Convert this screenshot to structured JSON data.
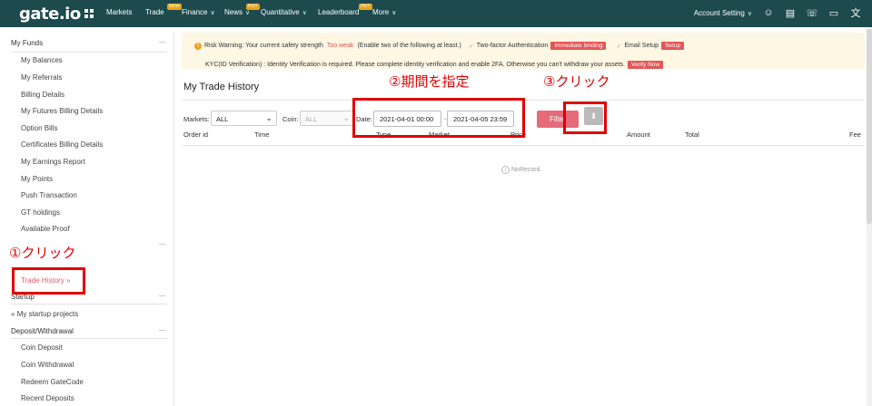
{
  "header": {
    "logo": "gate.io",
    "nav": [
      {
        "label": "Markets",
        "badge": ""
      },
      {
        "label": "Trade",
        "badge": "NEW"
      },
      {
        "label": "Finance",
        "badge": ""
      },
      {
        "label": "News",
        "badge": "HOT"
      },
      {
        "label": "Quantitative",
        "badge": ""
      },
      {
        "label": "Leaderboard",
        "badge": "HOT"
      },
      {
        "label": "More",
        "badge": ""
      }
    ],
    "account_setting": "Account Setting"
  },
  "sidebar": {
    "my_funds": "My Funds",
    "items": [
      "My Balances",
      "My Referrals",
      "Billing Details",
      "My Futures Billing Details",
      "Option Bills",
      "Certificates Billing Details",
      "My Earnings Report",
      "My Points",
      "Push Transaction",
      "GT holdings",
      "Available Proof"
    ],
    "trade_history": "Trade History",
    "trade_history_arrow": "»",
    "startup": "Startup",
    "startup_items": [
      "My startup projects"
    ],
    "deposit": "Deposit/Withdrawal",
    "deposit_items": [
      "Coin Deposit",
      "Coin Withdrawal",
      "Redeem GateCode",
      "Recent Deposits"
    ]
  },
  "warning": {
    "prefix": "Risk Warning: Your current safety strength",
    "strength": "Too weak",
    "enable_text": "(Enable two of the following at least.)",
    "two_factor": "Two-factor Authentication",
    "immediate_binding": "Immediate binding",
    "email_setup": "Email Setup",
    "setup": "Setup",
    "kyc_text": "KYC(ID Verification) : Identity Verification is required. Please complete identity verification and enable 2FA. Otherwise you can't withdraw your assets.",
    "verify_now": "Verify Now"
  },
  "page_title": "My Trade History",
  "filters": {
    "markets_label": "Markets:",
    "markets_value": "ALL",
    "coin_label": "Coin:",
    "coin_value": "ALL",
    "date_label": "Date:",
    "date_from": "2021-04-01 00:00",
    "date_to": "2021-04-05 23:59",
    "filter_button": "Filter"
  },
  "table": {
    "columns": [
      "Order id",
      "Time",
      "Type",
      "Market",
      "Price",
      "Amount",
      "Total",
      "Fee"
    ],
    "empty_text": "NoRecord."
  },
  "annotations": {
    "step1": "①クリック",
    "step2": "②期間を指定",
    "step3": "③クリック",
    "color": "#e10000"
  }
}
